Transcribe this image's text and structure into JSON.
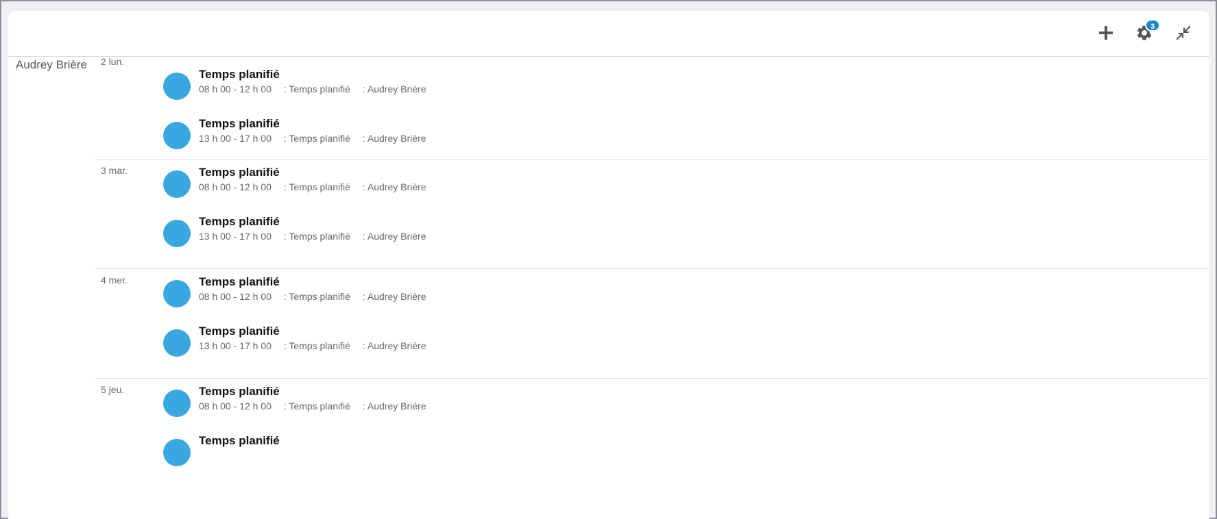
{
  "toolbar": {
    "add_icon": "plus-icon",
    "settings_icon": "gear-icon",
    "settings_badge": "3",
    "collapse_icon": "collapse-arrows-icon"
  },
  "person": {
    "name": "Audrey Brière"
  },
  "colors": {
    "event_dot": "#39a8e0",
    "badge": "#1a86d0"
  },
  "days": [
    {
      "label": "2 lun.",
      "events": [
        {
          "title": "Temps planifié",
          "time": "08 h 00 - 12 h 00",
          "type": ": Temps planifié",
          "person": ": Audrey Brière"
        },
        {
          "title": "Temps planifié",
          "time": "13 h 00 - 17 h 00",
          "type": ": Temps planifié",
          "person": ": Audrey Brière"
        }
      ]
    },
    {
      "label": "3 mar.",
      "events": [
        {
          "title": "Temps planifié",
          "time": "08 h 00 - 12 h 00",
          "type": ": Temps planifié",
          "person": ": Audrey Brière"
        },
        {
          "title": "Temps planifié",
          "time": "13 h 00 - 17 h 00",
          "type": ": Temps planifié",
          "person": ": Audrey Brière"
        }
      ]
    },
    {
      "label": "4 mer.",
      "events": [
        {
          "title": "Temps planifié",
          "time": "08 h 00 - 12 h 00",
          "type": ": Temps planifié",
          "person": ": Audrey Brière"
        },
        {
          "title": "Temps planifié",
          "time": "13 h 00 - 17 h 00",
          "type": ": Temps planifié",
          "person": ": Audrey Brière"
        }
      ]
    },
    {
      "label": "5 jeu.",
      "events": [
        {
          "title": "Temps planifié",
          "time": "08 h 00 - 12 h 00",
          "type": ": Temps planifié",
          "person": ": Audrey Brière"
        },
        {
          "title": "Temps planifié",
          "time": "",
          "type": "",
          "person": ""
        }
      ]
    }
  ]
}
